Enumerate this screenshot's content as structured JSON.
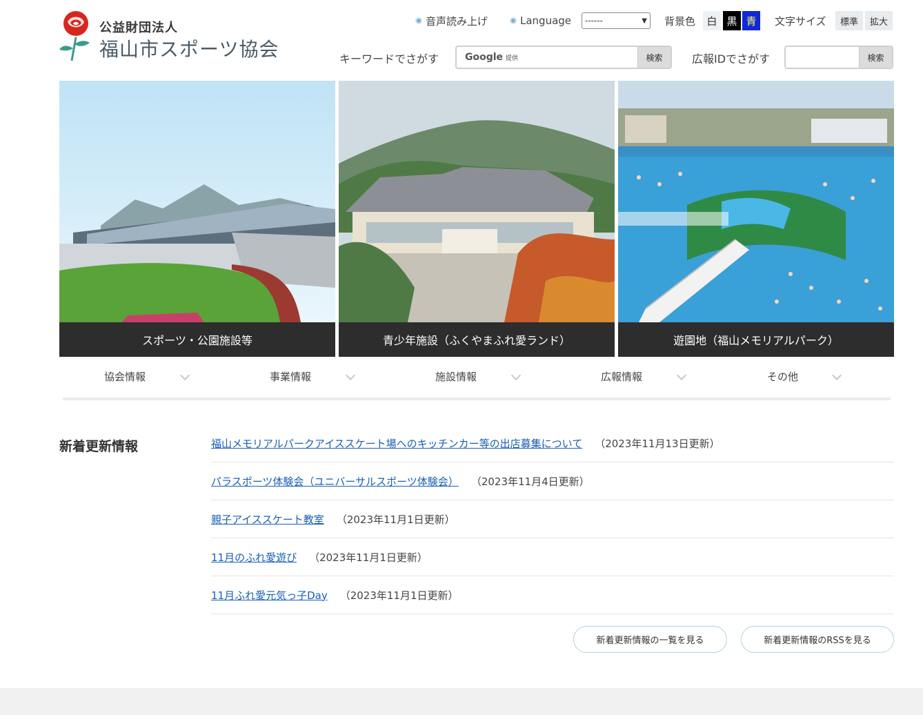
{
  "header": {
    "org_type": "公益財団法人",
    "org_name": "福山市スポーツ協会",
    "voice_read": "音声読み上げ",
    "language_label": "Language",
    "language_selected": "------",
    "bg_label": "背景色",
    "bg_white": "白",
    "bg_black": "黒",
    "bg_blue": "青",
    "font_label": "文字サイズ",
    "font_standard": "標準",
    "font_large": "拡大",
    "keyword_label": "キーワードでさがす",
    "google_brand": "Google",
    "google_provided": "提供",
    "keyword_button": "検索",
    "pr_id_label": "広報IDでさがす",
    "pr_id_button": "検索"
  },
  "hero": [
    {
      "caption": "スポーツ・公園施設等"
    },
    {
      "caption": "青少年施設（ふくやまふれ愛ランド）"
    },
    {
      "caption": "遊園地（福山メモリアルパーク）"
    }
  ],
  "nav": [
    {
      "label": "協会情報"
    },
    {
      "label": "事業情報"
    },
    {
      "label": "施設情報"
    },
    {
      "label": "広報情報"
    },
    {
      "label": "その他"
    }
  ],
  "news": {
    "heading": "新着更新情報",
    "items": [
      {
        "title": "福山メモリアルパークアイススケート場へのキッチンカー等の出店募集について",
        "date": "（2023年11月13日更新）"
      },
      {
        "title": "パラスポーツ体験会（ユニバーサルスポーツ体験会）",
        "date": "（2023年11月4日更新）"
      },
      {
        "title": "親子アイススケート教室",
        "date": "（2023年11月1日更新）"
      },
      {
        "title": "11月のふれ愛遊び",
        "date": "（2023年11月1日更新）"
      },
      {
        "title": "11月ふれ愛元気っ子Day",
        "date": "（2023年11月1日更新）"
      }
    ],
    "list_button": "新着更新情報の一覧を見る",
    "rss_button": "新着更新情報のRSSを見る"
  },
  "colors": {
    "link": "#1a5fb4",
    "caption_bg": "#2d2d2d",
    "bg_black_btn": "#000000",
    "bg_blue_btn": "#1028d8"
  }
}
